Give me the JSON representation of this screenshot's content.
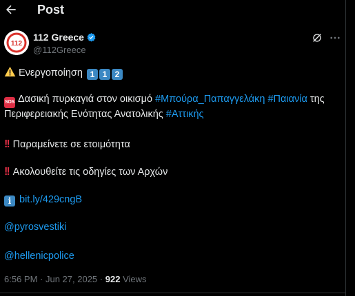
{
  "header": {
    "title": "Post"
  },
  "author": {
    "display_name": "112 Greece",
    "handle": "@112Greece",
    "avatar_text": "112"
  },
  "post": {
    "line1": {
      "text": "Ενεργοποίηση",
      "digits": [
        "1",
        "1",
        "2"
      ]
    },
    "line2": {
      "text_a": "Δασική πυρκαγιά στον οικισμό ",
      "hashtag_1": "#Μπούρα_Παπαγγελάκη",
      "hashtag_2": "#Παιανία",
      "text_b": " της",
      "text_c": "Περιφερειακής Ενότητας Ανατολικής ",
      "hashtag_3": "#Αττικής"
    },
    "line3": {
      "text": "Παραμείνετε σε ετοιμότητα"
    },
    "line4": {
      "text": "Ακολουθείτε τις οδηγίες των Αρχών"
    },
    "line5": {
      "link": "bit.ly/429cngB"
    },
    "mention_1": "@pyrosvestiki",
    "mention_2": "@hellenicpolice"
  },
  "meta": {
    "time": "6:56 PM",
    "date": "Jun 27, 2025",
    "separator": " · ",
    "views_count": "922",
    "views_label": "Views"
  },
  "icons": {
    "back": "arrow-left-icon",
    "verified": "verified-badge-icon",
    "grok": "grok-icon",
    "more": "more-icon",
    "warning": "warning-emoji-icon",
    "sos": "sos-emoji-icon",
    "double_exclamation": "double-exclamation-emoji-icon",
    "info": "information-emoji-icon"
  },
  "colors": {
    "accent": "#1d9bf0",
    "background": "#000000",
    "text": "#e7e9ea",
    "muted": "#71767b",
    "avatar_red": "#d9312b"
  }
}
